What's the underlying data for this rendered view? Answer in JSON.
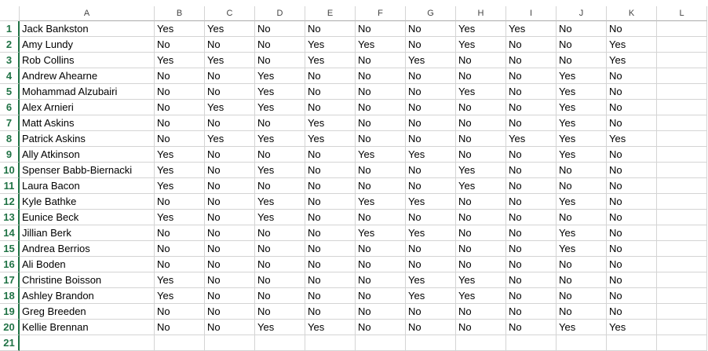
{
  "columns": [
    "A",
    "B",
    "C",
    "D",
    "E",
    "F",
    "G",
    "H",
    "I",
    "J",
    "K",
    "L"
  ],
  "row_numbers": [
    "1",
    "2",
    "3",
    "4",
    "5",
    "6",
    "7",
    "8",
    "9",
    "10",
    "11",
    "12",
    "13",
    "14",
    "15",
    "16",
    "17",
    "18",
    "19",
    "20",
    "21"
  ],
  "rows": [
    [
      "Jack Bankston",
      "Yes",
      "Yes",
      "No",
      "No",
      "No",
      "No",
      "Yes",
      "Yes",
      "No",
      "No",
      ""
    ],
    [
      "Amy Lundy",
      "No",
      "No",
      "No",
      "Yes",
      "Yes",
      "No",
      "Yes",
      "No",
      "No",
      "Yes",
      ""
    ],
    [
      "Rob Collins",
      "Yes",
      "Yes",
      "No",
      "Yes",
      "No",
      "Yes",
      "No",
      "No",
      "No",
      "Yes",
      ""
    ],
    [
      "Andrew Ahearne",
      "No",
      "No",
      "Yes",
      "No",
      "No",
      "No",
      "No",
      "No",
      "Yes",
      "No",
      ""
    ],
    [
      "Mohammad Alzubairi",
      "No",
      "No",
      "Yes",
      "No",
      "No",
      "No",
      "Yes",
      "No",
      "Yes",
      "No",
      ""
    ],
    [
      "Alex Arnieri",
      "No",
      "Yes",
      "Yes",
      "No",
      "No",
      "No",
      "No",
      "No",
      "Yes",
      "No",
      ""
    ],
    [
      "Matt Askins",
      "No",
      "No",
      "No",
      "Yes",
      "No",
      "No",
      "No",
      "No",
      "Yes",
      "No",
      ""
    ],
    [
      "Patrick Askins",
      "No",
      "Yes",
      "Yes",
      "Yes",
      "No",
      "No",
      "No",
      "Yes",
      "Yes",
      "Yes",
      ""
    ],
    [
      "Ally Atkinson",
      "Yes",
      "No",
      "No",
      "No",
      "Yes",
      "Yes",
      "No",
      "No",
      "Yes",
      "No",
      ""
    ],
    [
      "Spenser Babb-Biernacki",
      "Yes",
      "No",
      "Yes",
      "No",
      "No",
      "No",
      "Yes",
      "No",
      "No",
      "No",
      ""
    ],
    [
      "Laura Bacon",
      "Yes",
      "No",
      "No",
      "No",
      "No",
      "No",
      "Yes",
      "No",
      "No",
      "No",
      ""
    ],
    [
      "Kyle Bathke",
      "No",
      "No",
      "Yes",
      "No",
      "Yes",
      "Yes",
      "No",
      "No",
      "Yes",
      "No",
      ""
    ],
    [
      "Eunice Beck",
      "Yes",
      "No",
      "Yes",
      "No",
      "No",
      "No",
      "No",
      "No",
      "No",
      "No",
      ""
    ],
    [
      "Jillian Berk",
      "No",
      "No",
      "No",
      "No",
      "Yes",
      "Yes",
      "No",
      "No",
      "Yes",
      "No",
      ""
    ],
    [
      "Andrea Berrios",
      "No",
      "No",
      "No",
      "No",
      "No",
      "No",
      "No",
      "No",
      "Yes",
      "No",
      ""
    ],
    [
      "Ali Boden",
      "No",
      "No",
      "No",
      "No",
      "No",
      "No",
      "No",
      "No",
      "No",
      "No",
      ""
    ],
    [
      "Christine Boisson",
      "Yes",
      "No",
      "No",
      "No",
      "No",
      "Yes",
      "Yes",
      "No",
      "No",
      "No",
      ""
    ],
    [
      "Ashley Brandon",
      "Yes",
      "No",
      "No",
      "No",
      "No",
      "Yes",
      "Yes",
      "No",
      "No",
      "No",
      ""
    ],
    [
      "Greg Breeden",
      "No",
      "No",
      "No",
      "No",
      "No",
      "No",
      "No",
      "No",
      "No",
      "No",
      ""
    ],
    [
      "Kellie Brennan",
      "No",
      "No",
      "Yes",
      "Yes",
      "No",
      "No",
      "No",
      "No",
      "Yes",
      "Yes",
      ""
    ],
    [
      "",
      "",
      "",
      "",
      "",
      "",
      "",
      "",
      "",
      "",
      "",
      ""
    ]
  ]
}
